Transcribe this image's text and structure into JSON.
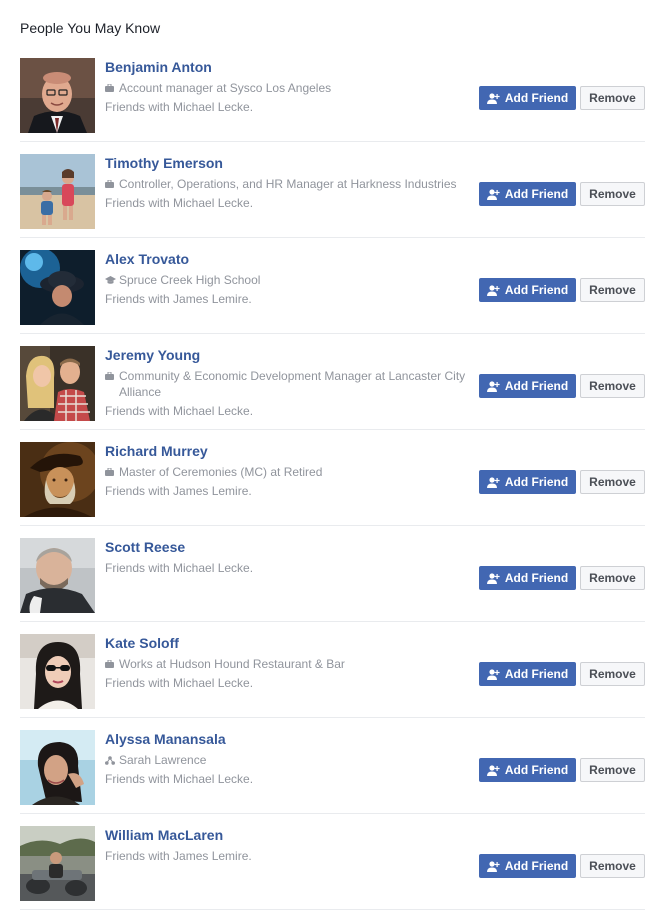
{
  "section_title": "People You May Know",
  "labels": {
    "add_friend": "Add Friend",
    "remove": "Remove"
  },
  "colors": {
    "link_blue": "#365899",
    "button_blue": "#4267b2",
    "meta_gray": "#90949c"
  },
  "people": [
    {
      "name": "Benjamin Anton",
      "detail_icon": "briefcase-icon",
      "detail": "Account manager at Sysco Los Angeles",
      "mutual": "Friends with Michael Lecke."
    },
    {
      "name": "Timothy Emerson",
      "detail_icon": "briefcase-icon",
      "detail": "Controller, Operations, and HR Manager at Harkness Industries",
      "mutual": "Friends with Michael Lecke."
    },
    {
      "name": "Alex Trovato",
      "detail_icon": "graduation-cap-icon",
      "detail": "Spruce Creek High School",
      "mutual": "Friends with James Lemire."
    },
    {
      "name": "Jeremy Young",
      "detail_icon": "briefcase-icon",
      "detail": "Community & Economic Development Manager at Lancaster City Alliance",
      "mutual": "Friends with Michael Lecke."
    },
    {
      "name": "Richard Murrey",
      "detail_icon": "briefcase-icon",
      "detail": "Master of Ceremonies (MC) at Retired",
      "mutual": "Friends with James Lemire."
    },
    {
      "name": "Scott Reese",
      "mutual": "Friends with Michael Lecke."
    },
    {
      "name": "Kate Soloff",
      "detail_icon": "briefcase-icon",
      "detail": "Works at Hudson Hound Restaurant & Bar",
      "mutual": "Friends with Michael Lecke."
    },
    {
      "name": "Alyssa Manansala",
      "detail_icon": "network-icon",
      "detail": "Sarah Lawrence",
      "mutual": "Friends with Michael Lecke."
    },
    {
      "name": "William MacLaren",
      "mutual": "Friends with James Lemire."
    }
  ]
}
